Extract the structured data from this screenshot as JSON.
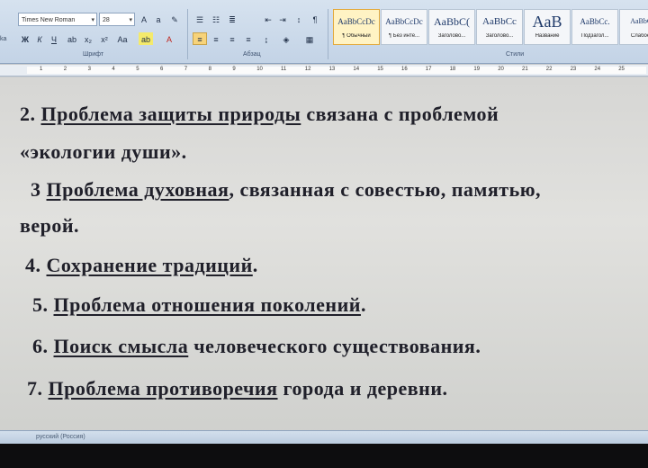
{
  "ribbon": {
    "font_name": "Times New Roman",
    "font_size": "28",
    "groups": {
      "font": "Шрифт",
      "paragraph": "Абзац",
      "styles": "Стили"
    },
    "style_tiles": [
      {
        "sample": "AaBbCcDc",
        "name": "¶ Обычный",
        "selected": true
      },
      {
        "sample": "AaBbCcDc",
        "name": "¶ Без инте...",
        "selected": false
      },
      {
        "sample": "AaBbC(",
        "name": "Заголово...",
        "selected": false
      },
      {
        "sample": "AaBbCc",
        "name": "Заголово...",
        "selected": false
      },
      {
        "sample": "AaB",
        "name": "Название",
        "selected": false
      },
      {
        "sample": "AaBbCc.",
        "name": "Подзагол...",
        "selected": false
      },
      {
        "sample": "AaBbCc",
        "name": "Слабое в",
        "selected": false
      }
    ],
    "left_edge_text": "ka"
  },
  "ruler": {
    "ticks": [
      "1",
      "2",
      "3",
      "4",
      "5",
      "6",
      "7",
      "8",
      "9",
      "10",
      "11",
      "12",
      "13",
      "14",
      "15",
      "16",
      "17",
      "18",
      "19",
      "20",
      "21",
      "22",
      "23",
      "24",
      "25"
    ]
  },
  "document": {
    "lines": [
      {
        "pre": "2. ",
        "u": "Проблема защиты природы",
        "post": " связана с проблемой"
      },
      {
        "pre": "«экологии души».",
        "u": "",
        "post": ""
      },
      {
        "pre": "3 ",
        "u": "Проблема духовная",
        "post": ", связанная с совестью, памятью,"
      },
      {
        "pre": "верой.",
        "u": "",
        "post": ""
      },
      {
        "pre": "4. ",
        "u": "Сохранение традиций",
        "post": "."
      },
      {
        "pre": "5. ",
        "u": "Проблема отношения поколений",
        "post": "."
      },
      {
        "pre": "6. ",
        "u": "Поиск смысла",
        "post": " человеческого существования."
      },
      {
        "pre": "7. ",
        "u": "Проблема противоречия",
        "post": " города и деревни."
      }
    ]
  },
  "status": {
    "language": "русский (Россия)"
  }
}
